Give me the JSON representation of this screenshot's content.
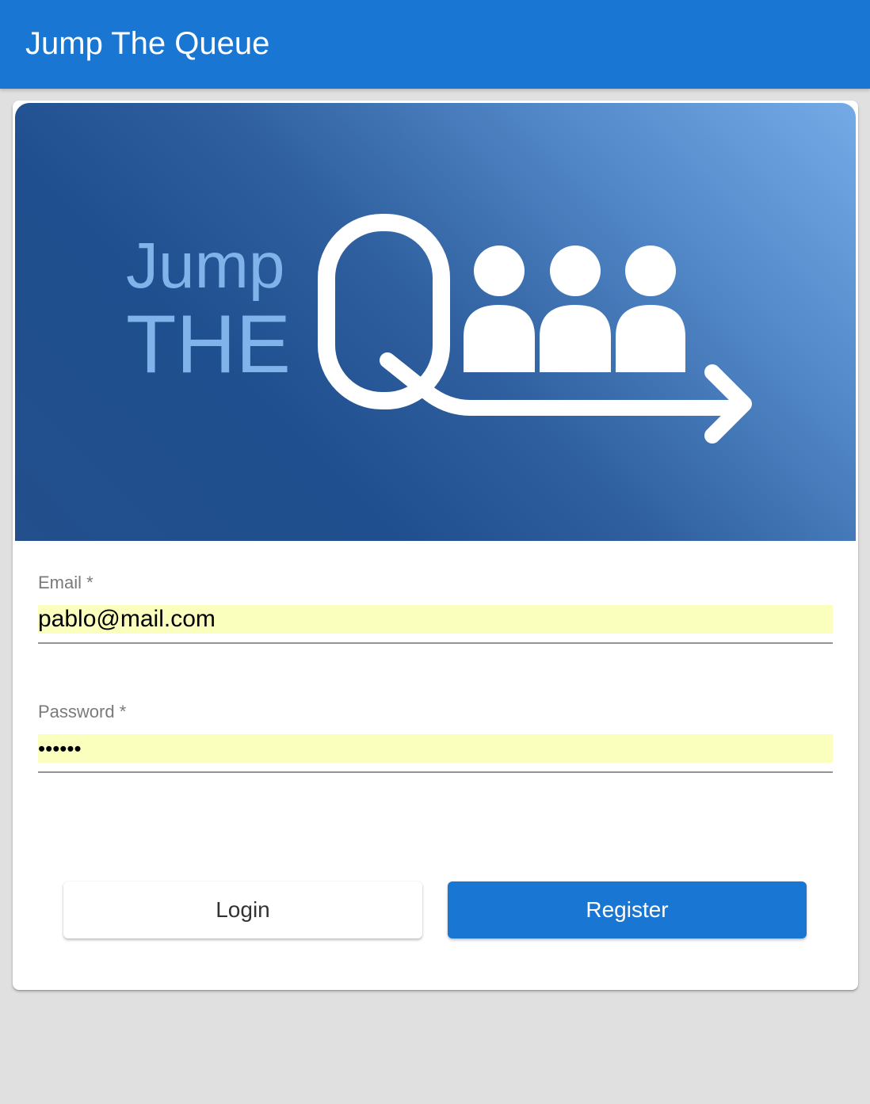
{
  "app": {
    "title": "Jump The Queue"
  },
  "banner": {
    "logo_line1": "Jump",
    "logo_line2": "THE"
  },
  "form": {
    "email": {
      "label": "Email *",
      "value": "pablo@mail.com"
    },
    "password": {
      "label": "Password *",
      "value_masked": "••••••"
    }
  },
  "actions": {
    "login_label": "Login",
    "register_label": "Register"
  },
  "colors": {
    "primary": "#1976d2",
    "autofill": "#faffbd",
    "background": "#e0e0e0"
  }
}
